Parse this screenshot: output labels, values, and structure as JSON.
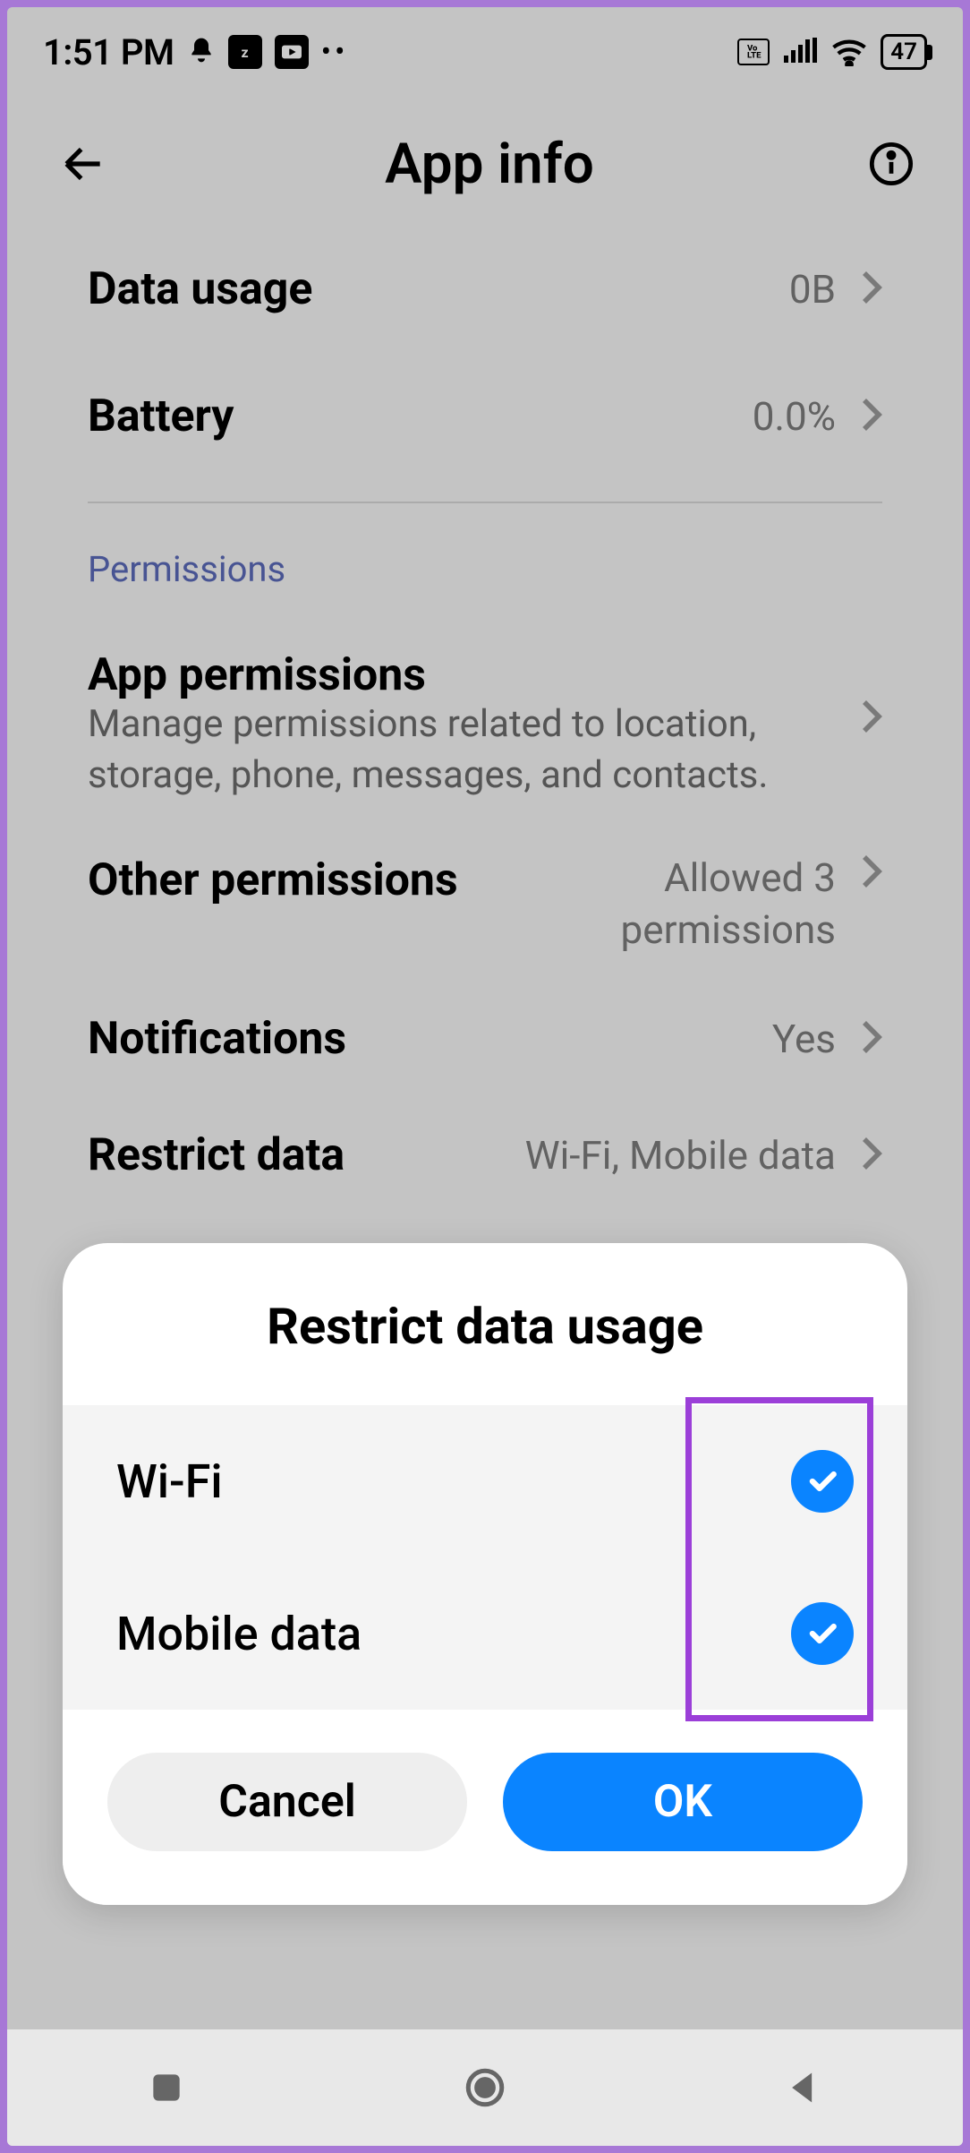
{
  "status": {
    "time": "1:51 PM",
    "icons": {
      "bell": "bell-icon",
      "app1": "zomato",
      "app2": "youtube"
    },
    "volte": "Vo LTE",
    "battery": "47"
  },
  "header": {
    "title": "App info"
  },
  "rows": {
    "data_usage": {
      "label": "Data usage",
      "value": "0B"
    },
    "battery": {
      "label": "Battery",
      "value": "0.0%"
    }
  },
  "permissions": {
    "section_label": "Permissions",
    "app_permissions": {
      "label": "App permissions",
      "desc": "Manage permissions related to location, storage, phone, messages, and contacts."
    },
    "other_permissions": {
      "label": "Other permissions",
      "value": "Allowed 3 permissions"
    },
    "notifications": {
      "label": "Notifications",
      "value": "Yes"
    },
    "restrict_data": {
      "label": "Restrict data",
      "value": "Wi-Fi, Mobile data"
    }
  },
  "dialog": {
    "title": "Restrict data usage",
    "options": {
      "wifi": {
        "label": "Wi-Fi",
        "checked": true
      },
      "mobile": {
        "label": "Mobile data",
        "checked": true
      }
    },
    "buttons": {
      "cancel": "Cancel",
      "ok": "OK"
    }
  }
}
